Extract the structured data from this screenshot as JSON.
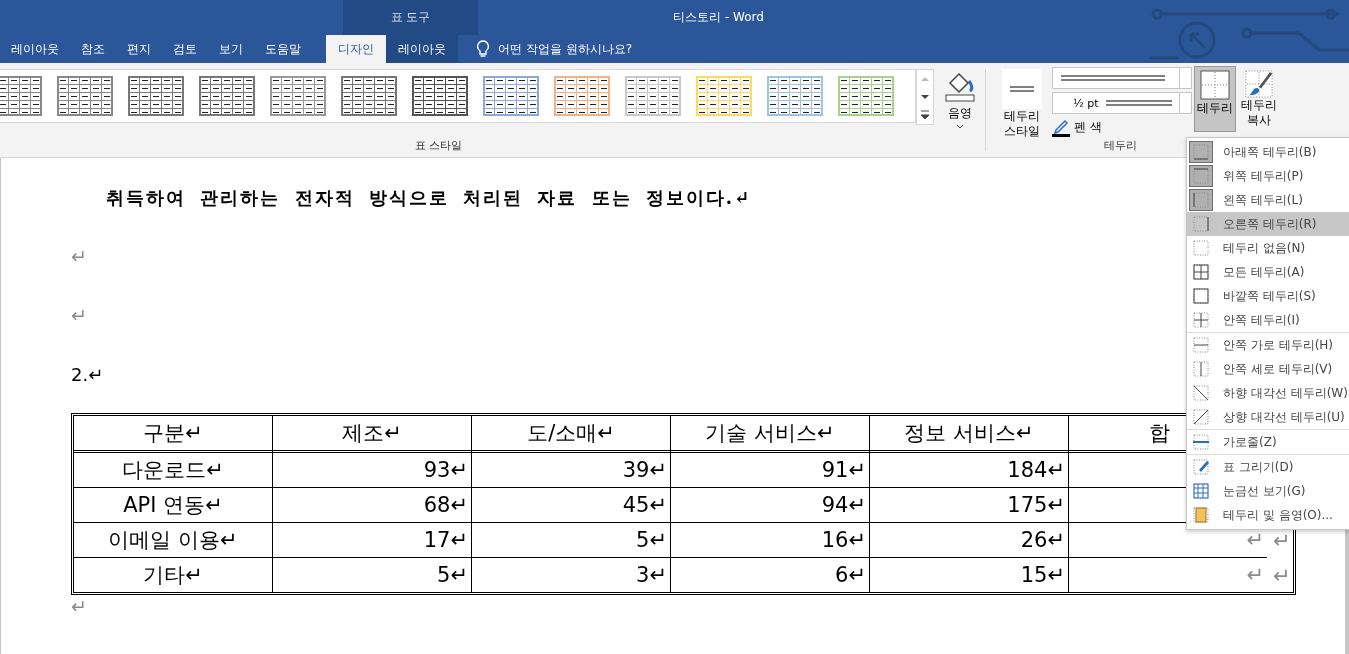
{
  "window": {
    "context_label": "표 도구",
    "title": "티스토리  -  Word"
  },
  "tabs": [
    {
      "label": "레이아웃",
      "selected": false,
      "contextual": false
    },
    {
      "label": "참조",
      "selected": false,
      "contextual": false
    },
    {
      "label": "편지",
      "selected": false,
      "contextual": false
    },
    {
      "label": "검토",
      "selected": false,
      "contextual": false
    },
    {
      "label": "보기",
      "selected": false,
      "contextual": false
    },
    {
      "label": "도움말",
      "selected": false,
      "contextual": false
    },
    {
      "label": "디자인",
      "selected": true,
      "contextual": true
    },
    {
      "label": "레이아웃",
      "selected": false,
      "contextual": true
    }
  ],
  "tell_me": "어떤 작업을 원하시나요?",
  "ribbon": {
    "table_styles": {
      "label": "표 스타일",
      "styles": [
        {
          "color": "#888888"
        },
        {
          "color": "#888888"
        },
        {
          "color": "#777777"
        },
        {
          "color": "#777777"
        },
        {
          "color": "#999999"
        },
        {
          "color": "#777777"
        },
        {
          "color": "#555555"
        },
        {
          "color": "#8eaadb"
        },
        {
          "color": "#f4b183"
        },
        {
          "color": "#c9c9c9"
        },
        {
          "color": "#ffd966"
        },
        {
          "color": "#9dc3e6"
        },
        {
          "color": "#a9d18e"
        }
      ]
    },
    "shading": "음영",
    "borders": {
      "label": "테두리",
      "style_button": "테두리 스타일",
      "weight": "½ pt",
      "pen_color": "펜 색",
      "borders_button": "테두리",
      "painter_button": "테두리 복사"
    }
  },
  "document": {
    "lines": [
      {
        "kind": "bold",
        "text": "취득하여 관리하는 전자적 방식으로 처리된 자료 또는 정보이다.↵"
      },
      {
        "kind": "plain",
        "text": "↵"
      },
      {
        "kind": "plain",
        "text": "↵"
      },
      {
        "kind": "plain",
        "text": "2.↵"
      }
    ],
    "table": {
      "columns": [
        "구분↵",
        "제조↵",
        "도/소매↵",
        "기술 서비스↵",
        "정보 서비스↵",
        "합"
      ],
      "rows": [
        {
          "cells": [
            "다운로드↵",
            "93↵",
            "39↵",
            "91↵",
            "184↵"
          ]
        },
        {
          "cells": [
            "API 연동↵",
            "68↵",
            "45↵",
            "94↵",
            "175↵"
          ]
        },
        {
          "cells": [
            "이메일 이용↵",
            "17↵",
            "5↵",
            "16↵",
            "26↵",
            "↵"
          ],
          "end_mark": "↵"
        },
        {
          "cells": [
            "기타↵",
            "5↵",
            "3↵",
            "6↵",
            "15↵",
            "↵"
          ],
          "end_mark": "↵"
        }
      ]
    },
    "after_mark": "↵"
  },
  "menu": [
    {
      "label": "아래쪽 테두리(B)",
      "checked": true,
      "selected": false,
      "separator_before": false
    },
    {
      "label": "위쪽 테두리(P)",
      "checked": true,
      "selected": false,
      "separator_before": false
    },
    {
      "label": "왼쪽 테두리(L)",
      "checked": true,
      "selected": false,
      "separator_before": false
    },
    {
      "label": "오른쪽 테두리(R)",
      "checked": false,
      "selected": true,
      "separator_before": false
    },
    {
      "label": "테두리 없음(N)",
      "checked": false,
      "selected": false,
      "separator_before": false
    },
    {
      "label": "모든 테두리(A)",
      "checked": false,
      "selected": false,
      "separator_before": false
    },
    {
      "label": "바깥쪽 테두리(S)",
      "checked": false,
      "selected": false,
      "separator_before": false
    },
    {
      "label": "안쪽 테두리(I)",
      "checked": false,
      "selected": false,
      "separator_before": false
    },
    {
      "label": "안쪽 가로 테두리(H)",
      "checked": false,
      "selected": false,
      "separator_before": true
    },
    {
      "label": "안쪽 세로 테두리(V)",
      "checked": false,
      "selected": false,
      "separator_before": false
    },
    {
      "label": "하향 대각선 테두리(W)",
      "checked": false,
      "selected": false,
      "separator_before": false
    },
    {
      "label": "상향 대각선 테두리(U)",
      "checked": false,
      "selected": false,
      "separator_before": false
    },
    {
      "label": "가로줄(Z)",
      "checked": false,
      "selected": false,
      "separator_before": true
    },
    {
      "label": "표 그리기(D)",
      "checked": false,
      "selected": false,
      "separator_before": true
    },
    {
      "label": "눈금선 보기(G)",
      "checked": false,
      "selected": false,
      "separator_before": false
    },
    {
      "label": "테두리 및 음영(O)...",
      "checked": false,
      "selected": false,
      "separator_before": false
    }
  ]
}
